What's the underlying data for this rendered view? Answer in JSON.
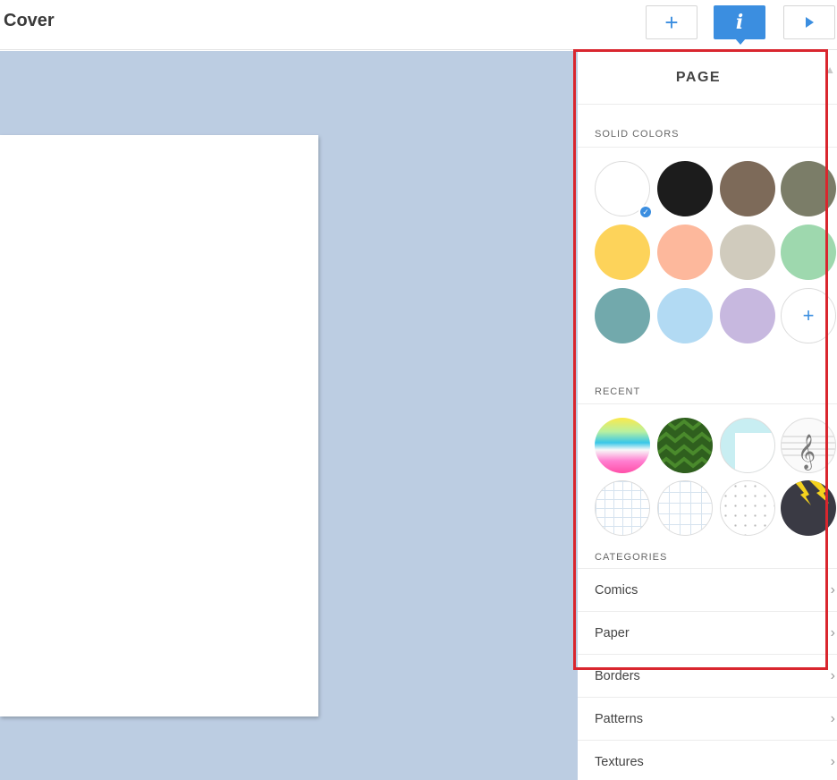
{
  "header": {
    "title": "Cover",
    "add_label": "+",
    "info_label": "i"
  },
  "panel": {
    "title": "PAGE",
    "solid_label": "SOLID COLORS",
    "recent_label": "RECENT",
    "categories_label": "CATEGORIES",
    "solid_colors": [
      {
        "color": "#ffffff",
        "selected": true
      },
      {
        "color": "#1c1c1c"
      },
      {
        "color": "#7d6a59"
      },
      {
        "color": "#7b7d68"
      },
      {
        "color": "#fdd35a"
      },
      {
        "color": "#fdb89c"
      },
      {
        "color": "#d0cbbd"
      },
      {
        "color": "#9ed8ae"
      },
      {
        "color": "#72a9ac"
      },
      {
        "color": "#b2daf3"
      },
      {
        "color": "#c7b8df"
      }
    ],
    "add_color_label": "+",
    "categories": [
      "Comics",
      "Paper",
      "Borders",
      "Patterns",
      "Textures"
    ]
  }
}
